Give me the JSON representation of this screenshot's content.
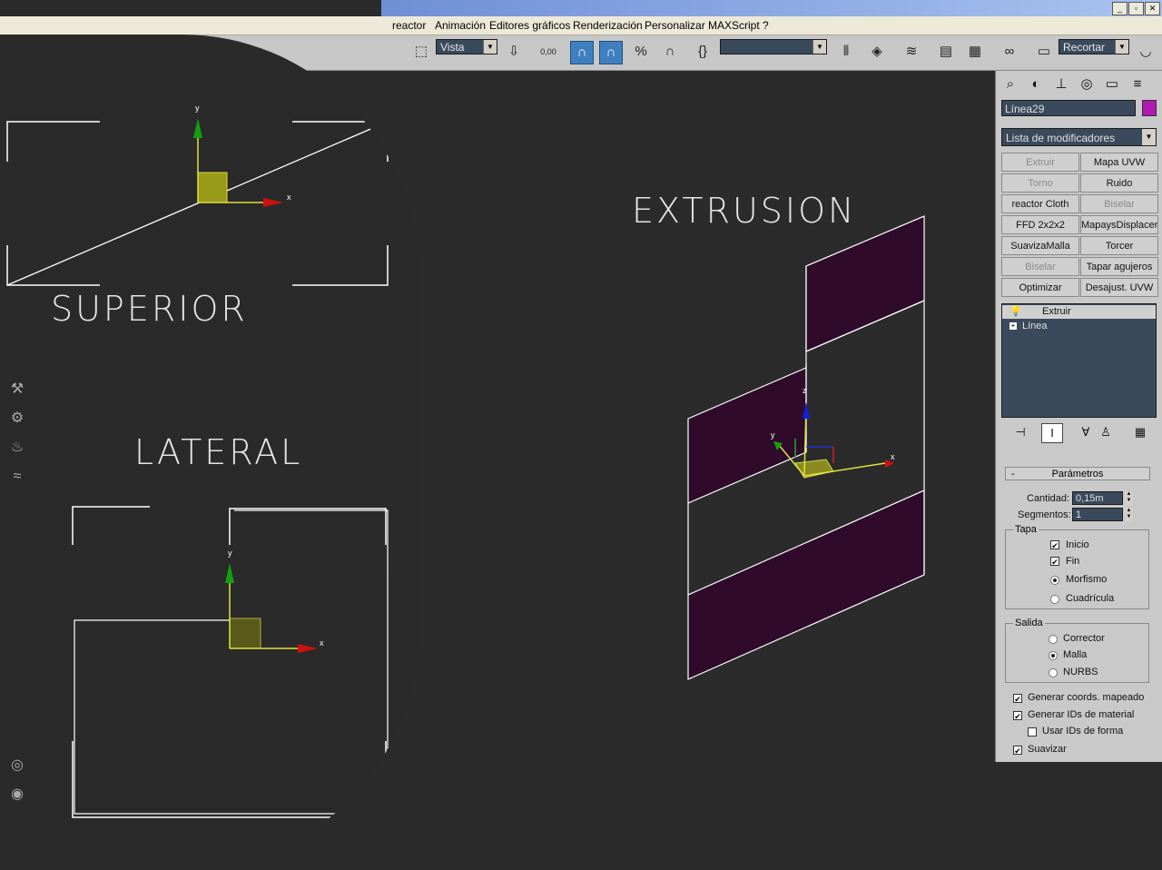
{
  "menu": [
    "reactor",
    "Animación",
    "Editores gráficos",
    "Renderización",
    "Personalizar",
    "MAXScript",
    "?"
  ],
  "window_buttons": [
    "_",
    "▫",
    "✕"
  ],
  "toolbar": {
    "view_select": "Vista",
    "snap_value": "0,00",
    "named_sel_placeholder": "",
    "crop_select": "Recortar"
  },
  "viewports": {
    "top_label": "SUPERIOR",
    "side_label": "LATERAL",
    "extrude_label": "EXTRUSION",
    "axis_x": "x",
    "axis_y": "y",
    "axis_z": "z"
  },
  "panel": {
    "object_name": "Línea29",
    "object_color": "#b01ab0",
    "modifier_list": "Lista de modificadores",
    "modifier_buttons": [
      {
        "label": "Extruir",
        "disabled": true
      },
      {
        "label": "Mapa UVW",
        "disabled": false
      },
      {
        "label": "Torno",
        "disabled": true
      },
      {
        "label": "Ruido",
        "disabled": false
      },
      {
        "label": "reactor Cloth",
        "disabled": false
      },
      {
        "label": "Biselar",
        "disabled": true
      },
      {
        "label": "FFD 2x2x2",
        "disabled": false
      },
      {
        "label": "MapaysDisplacementM",
        "disabled": false
      },
      {
        "label": "SuavizaMalla",
        "disabled": false
      },
      {
        "label": "Torcer",
        "disabled": false
      },
      {
        "label": "Biselar",
        "disabled": true
      },
      {
        "label": "Tapar agujeros",
        "disabled": false
      },
      {
        "label": "Optimizar",
        "disabled": false
      },
      {
        "label": "Desajust. UVW",
        "disabled": false
      }
    ],
    "stack": [
      {
        "label": "Extruir"
      },
      {
        "label": "Línea"
      }
    ],
    "rollout_title": "Parámetros",
    "cantidad_label": "Cantidad:",
    "cantidad_value": "0,15m",
    "segmentos_label": "Segmentos:",
    "segmentos_value": "1",
    "tapa_title": "Tapa",
    "tapa_options": [
      {
        "label": "Inicio",
        "checked": true
      },
      {
        "label": "Fin",
        "checked": true
      }
    ],
    "tapa_radios": [
      {
        "label": "Morfismo",
        "selected": true
      },
      {
        "label": "Cuadrícula",
        "selected": false
      }
    ],
    "salida_title": "Salida",
    "salida_radios": [
      {
        "label": "Corrector",
        "selected": false
      },
      {
        "label": "Malla",
        "selected": true
      },
      {
        "label": "NURBS",
        "selected": false
      }
    ],
    "bottom_checks": [
      {
        "label": "Generar coords. mapeado",
        "checked": true
      },
      {
        "label": "Generar IDs de material",
        "checked": true
      },
      {
        "label": "Usar IDs de forma",
        "checked": false
      },
      {
        "label": "Suavizar",
        "checked": true
      }
    ]
  }
}
